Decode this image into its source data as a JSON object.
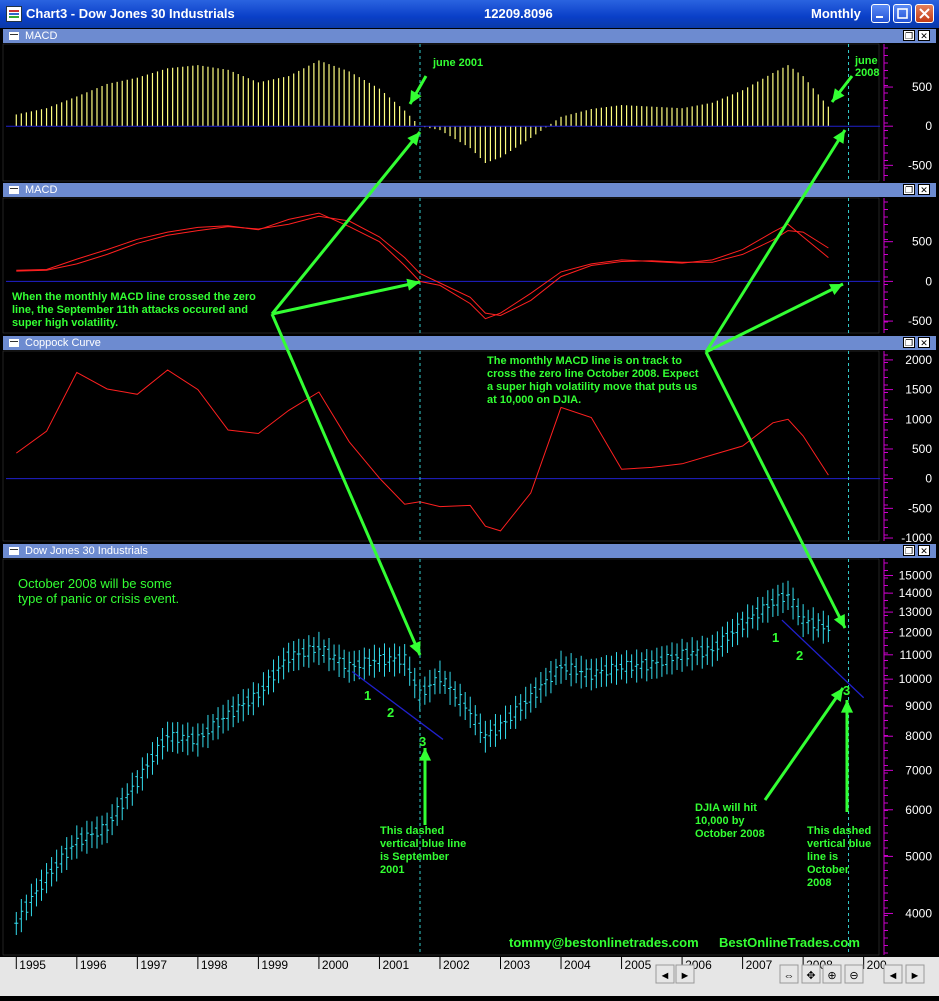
{
  "window": {
    "title": "Chart3 - Dow Jones 30 Industrials",
    "last_value": "12209.8096",
    "period": "Monthly",
    "minimize_symbol": "–",
    "maximize_symbol": "□",
    "close_symbol": "✕"
  },
  "pane_buttons": {
    "restore": "❐",
    "close": "✕"
  },
  "panes": [
    {
      "title": "MACD",
      "ticks": [
        "500",
        "0",
        "-500"
      ]
    },
    {
      "title": "MACD",
      "ticks": [
        "500",
        "0",
        "-500"
      ]
    },
    {
      "title": "Coppock Curve",
      "ticks": [
        "2000",
        "1500",
        "1000",
        "500",
        "0",
        "-500",
        "-1000"
      ]
    },
    {
      "title": "Dow Jones 30 Industrials",
      "ticks": [
        "15000",
        "14000",
        "13000",
        "12000",
        "11000",
        "10000",
        "9000",
        "8000",
        "7000",
        "6000",
        "5000",
        "4000"
      ]
    }
  ],
  "x_axis": {
    "years": [
      "1995",
      "1996",
      "1997",
      "1998",
      "1999",
      "2000",
      "2001",
      "2002",
      "2003",
      "2004",
      "2005",
      "2006",
      "2007",
      "2008",
      "200"
    ],
    "scroll_symbols": [
      "◄",
      "►",
      "⇔",
      "✥",
      "⊕",
      "⊖",
      "◄",
      "►"
    ]
  },
  "annotations": {
    "june2001": "june 2001",
    "june2008_a": "june",
    "june2008_b": "2008",
    "macd_zero_note": [
      "When the monthly MACD line crossed the zero",
      "line, the September 11th attacks occured and",
      "super high volatility."
    ],
    "track_note": [
      "The monthly MACD line is on track to",
      "cross the zero line October 2008. Expect",
      "a super high volatility move that puts us",
      "at 10,000 on DJIA."
    ],
    "panic_note": [
      "October 2008 will be some",
      "type of panic or crisis event."
    ],
    "dashed_sept_note": [
      "This dashed",
      "vertical blue line",
      "is September",
      "2001"
    ],
    "djia_note": [
      "DJIA will hit",
      "10,000 by",
      "October 2008"
    ],
    "dashed_oct_note": [
      "This dashed",
      "vertical blue",
      "line is",
      "October",
      "2008"
    ],
    "wave_labels_2001": [
      "1",
      "2",
      "3"
    ],
    "wave_labels_2008": [
      "1",
      "2",
      "3"
    ],
    "email": "tommy@bestonlinetrades.com",
    "site": "BestOnlineTrades.com"
  },
  "colors": {
    "background": "#000000",
    "histogram": "#ffff80",
    "macd_lines": "#ff2020",
    "coppock": "#ff2020",
    "price_bars": "#33ddee",
    "zero_line": "#2020cc",
    "annotation": "#33ff33",
    "axis_ticks": "#cc00cc",
    "dashed_marker": "#33cccc"
  },
  "chart_data": [
    {
      "type": "bar",
      "title": "MACD",
      "series_name": "MACD histogram",
      "x": [
        "1995-01",
        "1995-07",
        "1996-01",
        "1996-07",
        "1997-01",
        "1997-07",
        "1998-01",
        "1998-07",
        "1999-01",
        "1999-07",
        "2000-01",
        "2000-07",
        "2001-01",
        "2001-06",
        "2001-09",
        "2002-01",
        "2002-07",
        "2002-10",
        "2003-01",
        "2003-07",
        "2004-01",
        "2004-07",
        "2005-01",
        "2005-07",
        "2006-01",
        "2006-07",
        "2007-01",
        "2007-07",
        "2007-10",
        "2008-01",
        "2008-06"
      ],
      "values": [
        150,
        230,
        380,
        540,
        620,
        740,
        780,
        720,
        560,
        640,
        840,
        700,
        480,
        200,
        0,
        -50,
        -280,
        -470,
        -400,
        -150,
        120,
        220,
        270,
        250,
        230,
        300,
        460,
        680,
        780,
        640,
        250
      ],
      "ylim": [
        -700,
        1050
      ]
    },
    {
      "type": "line",
      "title": "MACD",
      "x": [
        "1995-01",
        "1995-07",
        "1996-01",
        "1996-07",
        "1997-01",
        "1997-07",
        "1998-01",
        "1998-07",
        "1999-01",
        "1999-07",
        "2000-01",
        "2000-07",
        "2001-01",
        "2001-06",
        "2001-09",
        "2002-01",
        "2002-07",
        "2002-10",
        "2003-01",
        "2003-07",
        "2004-01",
        "2004-07",
        "2005-01",
        "2005-07",
        "2006-01",
        "2006-07",
        "2007-01",
        "2007-07",
        "2007-10",
        "2008-01",
        "2008-06"
      ],
      "series": [
        {
          "values": [
            140,
            150,
            280,
            400,
            530,
            620,
            680,
            700,
            650,
            780,
            860,
            690,
            500,
            200,
            0,
            -50,
            -280,
            -470,
            -400,
            -150,
            120,
            220,
            270,
            250,
            230,
            270,
            400,
            620,
            720,
            560,
            300
          ]
        },
        {
          "values": [
            130,
            140,
            220,
            340,
            480,
            580,
            640,
            690,
            660,
            720,
            820,
            760,
            560,
            300,
            100,
            -20,
            -200,
            -400,
            -430,
            -240,
            60,
            200,
            250,
            260,
            240,
            240,
            340,
            520,
            640,
            620,
            420
          ]
        }
      ],
      "ylim": [
        -650,
        1050
      ]
    },
    {
      "type": "line",
      "title": "Coppock Curve",
      "x": [
        "1995-01",
        "1995-07",
        "1996-01",
        "1996-07",
        "1997-01",
        "1997-07",
        "1998-01",
        "1998-07",
        "1999-01",
        "1999-07",
        "2000-01",
        "2000-07",
        "2001-01",
        "2001-06",
        "2001-09",
        "2002-01",
        "2002-07",
        "2002-10",
        "2003-01",
        "2003-07",
        "2004-01",
        "2004-07",
        "2005-01",
        "2005-07",
        "2006-01",
        "2006-07",
        "2007-01",
        "2007-07",
        "2007-10",
        "2008-01",
        "2008-06"
      ],
      "values": [
        430,
        800,
        1790,
        1510,
        1420,
        1830,
        1500,
        820,
        760,
        1150,
        1460,
        620,
        10,
        -430,
        -390,
        -470,
        -450,
        -800,
        -880,
        -240,
        1200,
        1030,
        160,
        190,
        250,
        400,
        550,
        940,
        1000,
        720,
        60
      ],
      "ylim": [
        -1050,
        2150
      ]
    },
    {
      "type": "line",
      "title": "Dow Jones 30 Industrials",
      "scale": "log",
      "x": [
        "1995-01",
        "1995-07",
        "1996-01",
        "1996-07",
        "1997-01",
        "1997-07",
        "1998-01",
        "1998-07",
        "1999-01",
        "1999-07",
        "2000-01",
        "2000-07",
        "2001-01",
        "2001-06",
        "2001-09",
        "2002-01",
        "2002-07",
        "2002-10",
        "2003-01",
        "2003-07",
        "2004-01",
        "2004-07",
        "2005-01",
        "2005-07",
        "2006-01",
        "2006-07",
        "2007-01",
        "2007-07",
        "2007-10",
        "2008-01",
        "2008-06"
      ],
      "values": [
        3850,
        4600,
        5300,
        5600,
        6700,
        8000,
        7900,
        8700,
        9400,
        10900,
        11300,
        10500,
        10800,
        10800,
        9400,
        10100,
        8800,
        8000,
        8300,
        9300,
        10500,
        10200,
        10500,
        10600,
        11000,
        11200,
        12400,
        13500,
        13900,
        12600,
        12200
      ],
      "ylim": [
        3400,
        16000
      ]
    }
  ]
}
